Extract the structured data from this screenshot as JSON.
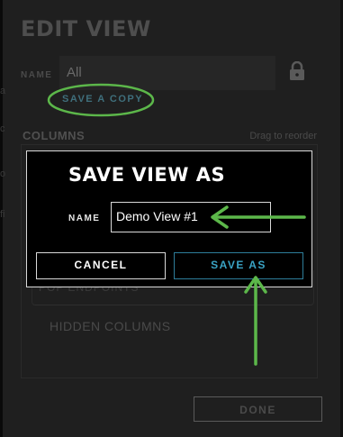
{
  "edit_view": {
    "title": "EDIT VIEW",
    "name_label": "NAME",
    "name_value": "All",
    "lock_icon": "lock-icon",
    "save_copy_label": "SAVE A COPY",
    "columns_label": "COLUMNS",
    "drag_hint": "Drag to reorder",
    "partial_row_text": "POP ENDPOINTS",
    "hidden_columns_label": "HIDDEN COLUMNS",
    "done_label": "DONE",
    "edge_letters": [
      "a",
      "c",
      "o",
      "fi"
    ]
  },
  "modal": {
    "title": "SAVE VIEW AS",
    "name_label": "NAME",
    "name_value": "Demo View #1",
    "cancel_label": "CANCEL",
    "save_as_label": "SAVE AS"
  },
  "colors": {
    "annotation_green": "#5cb74a",
    "accent_blue": "#2e7e9a",
    "modal_border": "#d9d9d9"
  }
}
